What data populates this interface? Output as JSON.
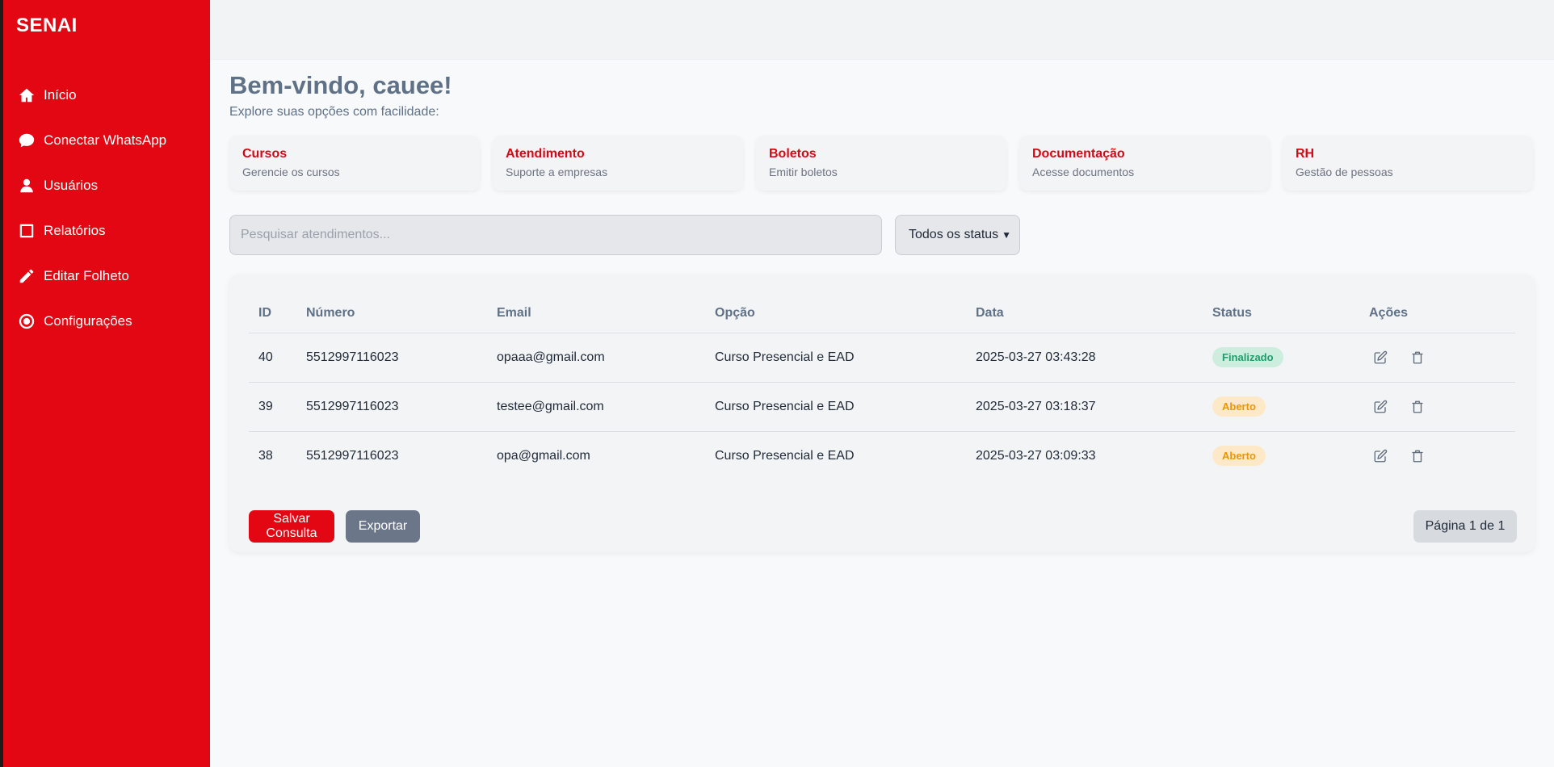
{
  "sidebar": {
    "brand": "SENAI",
    "items": [
      {
        "label": "Início",
        "icon": "home-icon"
      },
      {
        "label": "Conectar WhatsApp",
        "icon": "chat-bubble-icon"
      },
      {
        "label": "Usuários",
        "icon": "user-icon"
      },
      {
        "label": "Relatórios",
        "icon": "square-icon"
      },
      {
        "label": "Editar Folheto",
        "icon": "pencil-icon"
      },
      {
        "label": "Configurações",
        "icon": "circle-dot-icon"
      }
    ],
    "background_color": "#e30613"
  },
  "main": {
    "welcome": "Bem-vindo, cauee!",
    "subtitle": "Explore suas opções com facilidade:",
    "cards": [
      {
        "title": "Cursos",
        "desc": "Gerencie os cursos"
      },
      {
        "title": "Atendimento",
        "desc": "Suporte a empresas"
      },
      {
        "title": "Boletos",
        "desc": "Emitir boletos"
      },
      {
        "title": "Documentação",
        "desc": "Acesse documentos"
      },
      {
        "title": "RH",
        "desc": "Gestão de pessoas"
      }
    ],
    "search": {
      "placeholder": "Pesquisar atendimentos...",
      "value": ""
    },
    "status_filter": {
      "selected": "Todos os status"
    }
  },
  "table": {
    "headers": [
      "ID",
      "Número",
      "Email",
      "Opção",
      "Data",
      "Status",
      "Ações"
    ],
    "rows": [
      {
        "id": "40",
        "numero": "5512997116023",
        "email": "opaaa@gmail.com",
        "opcao": "Curso Presencial e EAD",
        "data": "2025-03-27 03:43:28",
        "status": "Finalizado",
        "status_kind": "done"
      },
      {
        "id": "39",
        "numero": "5512997116023",
        "email": "testee@gmail.com",
        "opcao": "Curso Presencial e EAD",
        "data": "2025-03-27 03:18:37",
        "status": "Aberto",
        "status_kind": "open"
      },
      {
        "id": "38",
        "numero": "5512997116023",
        "email": "opa@gmail.com",
        "opcao": "Curso Presencial e EAD",
        "data": "2025-03-27 03:09:33",
        "status": "Aberto",
        "status_kind": "open"
      }
    ]
  },
  "footer": {
    "save_label": "Salvar Consulta",
    "export_label": "Exportar",
    "pagination": "Página 1 de 1"
  }
}
